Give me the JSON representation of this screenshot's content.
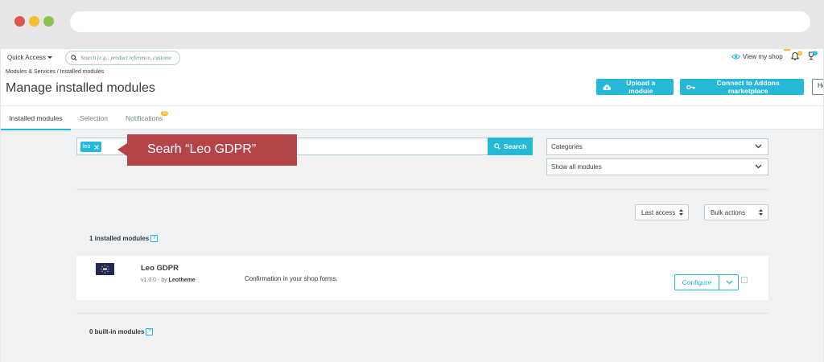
{
  "colors": {
    "accent": "#25b9d7",
    "callout": "#b5444a",
    "badge_yellow": "#fbbb22",
    "traffic_red": "#e0554f",
    "traffic_yellow": "#f3bf2f",
    "traffic_green": "#8bc34a"
  },
  "topbar": {
    "quick_access": "Quick Access",
    "search_placeholder": "Search (e.g.: product reference, custome",
    "view_shop": "View my shop",
    "notifications_count": "0",
    "trophy_count": "7"
  },
  "header": {
    "breadcrumb": "Modules & Services  /  Installed modules",
    "title": "Manage installed modules",
    "upload_label": "Upload a module",
    "connect_label": "Connect to Addons marketplace",
    "help_label": "He"
  },
  "tabs": {
    "installed": "Installed modules",
    "selection": "Selection",
    "notifications": "Notifications",
    "notifications_badge": "10"
  },
  "filters": {
    "tag": "leo",
    "search_label": "Search",
    "categories": "Categories",
    "show_modules": "Show all modules"
  },
  "callout": {
    "text": "Searh “Leo GDPR”"
  },
  "sort": {
    "last_access": "Last access",
    "bulk_actions": "Bulk actions"
  },
  "sections": {
    "installed": "1 installed modules",
    "builtin": "0 built-in modules",
    "help": "?"
  },
  "module": {
    "name": "Leo GDPR",
    "version": "v1.0.0 - by ",
    "author": "Leotheme",
    "description": "Confirmation in your shop forms.",
    "configure_label": "Configure"
  }
}
